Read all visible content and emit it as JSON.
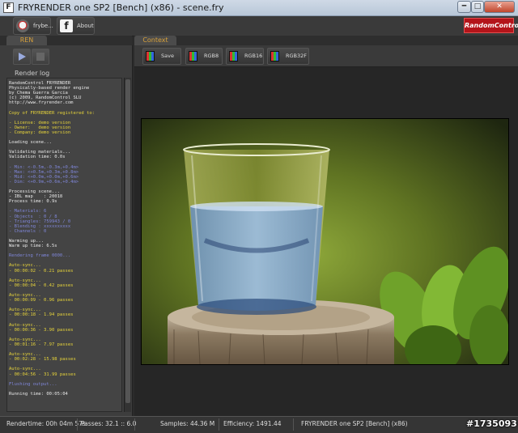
{
  "window": {
    "title": "FRYRENDER one SP2 [Bench] (x86) - scene.fry",
    "app_icon": "F"
  },
  "toolbar": {
    "fry_label": "frybe...",
    "about_label": "About",
    "brand_logo": "RandomControl"
  },
  "tabs": {
    "left": "REN",
    "right": "Context"
  },
  "left_panel": {
    "render_log_title": "Render log"
  },
  "colors": {
    "log_white": "#e8e8e8",
    "log_yellow": "#e6d33a",
    "log_blue": "#7f86d8",
    "tab_orange": "#d7a03a",
    "logo_red": "#b4141a"
  },
  "log_lines": [
    {
      "t": "RandomControl FRYRENDER",
      "c": "w"
    },
    {
      "t": "Physically-based render engine",
      "c": "w"
    },
    {
      "t": "by Chema Guerra Garcia",
      "c": "w"
    },
    {
      "t": "(c) 2009, RandomControl SLU",
      "c": "w"
    },
    {
      "t": "http://www.fryrender.com",
      "c": "w"
    },
    {
      "t": "",
      "c": "w"
    },
    {
      "t": "Copy of FRYRENDER registered to:",
      "c": "y"
    },
    {
      "t": "",
      "c": "w"
    },
    {
      "t": "- License: demo version",
      "c": "y"
    },
    {
      "t": "- Owner:   demo version",
      "c": "y"
    },
    {
      "t": "- Company: demo version",
      "c": "y"
    },
    {
      "t": "",
      "c": "w"
    },
    {
      "t": "Loading scene...",
      "c": "w"
    },
    {
      "t": "",
      "c": "w"
    },
    {
      "t": "Validating materials...",
      "c": "w"
    },
    {
      "t": "Validation time: 0.0s",
      "c": "w"
    },
    {
      "t": "",
      "c": "w"
    },
    {
      "t": "- Min: <-0.5m,-0.3m,+0.4m>",
      "c": "b"
    },
    {
      "t": "- Max: <+0.5m,+0.3m,+0.8m>",
      "c": "b"
    },
    {
      "t": "- Mid: <+0.0m,+0.0m,+0.6m>",
      "c": "b"
    },
    {
      "t": "- Dim: <+0.9m,+0.6m,+0.4m>",
      "c": "b"
    },
    {
      "t": "",
      "c": "w"
    },
    {
      "t": "Processing scene...",
      "c": "w"
    },
    {
      "t": "- IBL map    : 20018",
      "c": "w"
    },
    {
      "t": "Process time: 0.9s",
      "c": "w"
    },
    {
      "t": "",
      "c": "w"
    },
    {
      "t": "- Materials: 6",
      "c": "b"
    },
    {
      "t": "- Objects  : 0 / 8",
      "c": "b"
    },
    {
      "t": "- Triangles: 759943 / 0",
      "c": "b"
    },
    {
      "t": "- Blending : xxxxxxxxxx",
      "c": "b"
    },
    {
      "t": "- Channels : 0",
      "c": "b"
    },
    {
      "t": "",
      "c": "w"
    },
    {
      "t": "Warming up...",
      "c": "w"
    },
    {
      "t": "Warm up time: 6.5s",
      "c": "w"
    },
    {
      "t": "",
      "c": "w"
    },
    {
      "t": "Rendering frame 0000...",
      "c": "b"
    },
    {
      "t": "",
      "c": "w"
    },
    {
      "t": "Auto-sync...",
      "c": "y"
    },
    {
      "t": "- 00:00:02 - 0.21 passes",
      "c": "y"
    },
    {
      "t": "",
      "c": "w"
    },
    {
      "t": "Auto-sync...",
      "c": "y"
    },
    {
      "t": "- 00:00:04 - 0.42 passes",
      "c": "y"
    },
    {
      "t": "",
      "c": "w"
    },
    {
      "t": "Auto-sync...",
      "c": "y"
    },
    {
      "t": "- 00:00:09 - 0.96 passes",
      "c": "y"
    },
    {
      "t": "",
      "c": "w"
    },
    {
      "t": "Auto-sync...",
      "c": "y"
    },
    {
      "t": "- 00:00:18 - 1.94 passes",
      "c": "y"
    },
    {
      "t": "",
      "c": "w"
    },
    {
      "t": "Auto-sync...",
      "c": "y"
    },
    {
      "t": "- 00:00:36 - 3.90 passes",
      "c": "y"
    },
    {
      "t": "",
      "c": "w"
    },
    {
      "t": "Auto-sync...",
      "c": "y"
    },
    {
      "t": "- 00:01:16 - 7.97 passes",
      "c": "y"
    },
    {
      "t": "",
      "c": "w"
    },
    {
      "t": "Auto-sync...",
      "c": "y"
    },
    {
      "t": "- 00:02:28 - 15.98 passes",
      "c": "y"
    },
    {
      "t": "",
      "c": "w"
    },
    {
      "t": "Auto-sync...",
      "c": "y"
    },
    {
      "t": "- 00:04:56 - 31.99 passes",
      "c": "y"
    },
    {
      "t": "",
      "c": "w"
    },
    {
      "t": "Flushing output...",
      "c": "b"
    },
    {
      "t": "",
      "c": "w"
    },
    {
      "t": "Running time: 00:05:04",
      "c": "w"
    }
  ],
  "context_bar": {
    "save_label": "Save",
    "rgb8_label": "RGB8",
    "rgb16_label": "RGB16",
    "rgb32f_label": "RGB32F"
  },
  "status": {
    "rendertime": "Rendertime:  00h 04m 57s",
    "passes": "Passes:  32.1 :: 6.0",
    "samples": "Samples:  44.36 M",
    "efficiency": "Efficiency:  1491.44",
    "version": "FRYRENDER one SP2 [Bench] (x86)"
  },
  "watermark": "#1735093"
}
